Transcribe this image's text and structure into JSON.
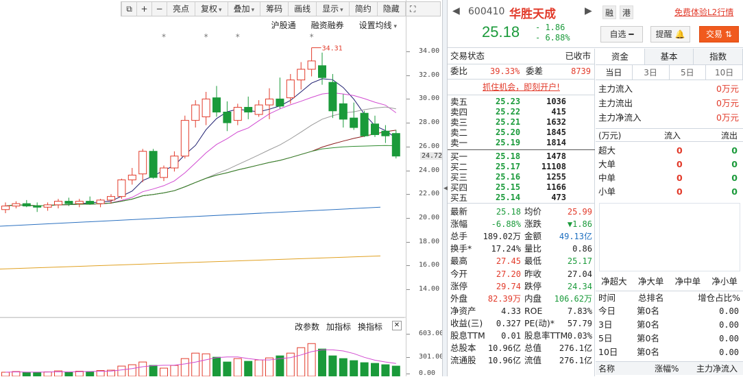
{
  "toolbar": {
    "items": [
      "亮点",
      "复权",
      "叠加",
      "筹码",
      "画线",
      "显示",
      "简约",
      "隐藏"
    ]
  },
  "subbar": {
    "hk": "沪股通",
    "margin": "融资融券",
    "ma": "设置均线"
  },
  "chart_data": {
    "type": "candlestick",
    "max_label": "34.31",
    "yticks": [
      "34.00",
      "32.00",
      "30.00",
      "28.00",
      "26.00",
      "24.00",
      "22.00",
      "20.00",
      "18.00",
      "16.00",
      "14.00"
    ],
    "y_current": "24.72",
    "vol_ticks": [
      "603.00",
      "301.00",
      "0.00"
    ],
    "ylim": [
      13,
      35.5
    ],
    "candles": [
      [
        20.7,
        21.3,
        20.4,
        21.0
      ],
      [
        21.0,
        21.4,
        20.8,
        21.2
      ],
      [
        21.2,
        21.5,
        20.9,
        21.0
      ],
      [
        21.0,
        21.3,
        20.5,
        20.9
      ],
      [
        20.9,
        21.3,
        20.6,
        21.1
      ],
      [
        21.1,
        21.6,
        20.8,
        21.4
      ],
      [
        21.4,
        21.7,
        21.0,
        21.2
      ],
      [
        21.2,
        21.6,
        20.9,
        21.4
      ],
      [
        21.4,
        21.8,
        21.1,
        21.2
      ],
      [
        21.2,
        21.6,
        20.9,
        21.5
      ],
      [
        21.5,
        22.0,
        21.2,
        21.8
      ],
      [
        21.8,
        23.3,
        21.6,
        23.2
      ],
      [
        23.2,
        24.2,
        22.8,
        23.6
      ],
      [
        23.7,
        25.8,
        23.0,
        25.6
      ],
      [
        25.6,
        25.8,
        23.3,
        23.4
      ],
      [
        23.4,
        24.4,
        23.1,
        24.2
      ],
      [
        24.2,
        25.6,
        23.9,
        25.2
      ],
      [
        25.2,
        28.6,
        25.0,
        28.2
      ],
      [
        28.2,
        29.9,
        27.6,
        29.5
      ],
      [
        28.5,
        30.6,
        27.8,
        30.0
      ],
      [
        30.1,
        31.1,
        28.5,
        28.9
      ],
      [
        28.9,
        29.8,
        27.3,
        28.0
      ],
      [
        28.2,
        29.6,
        27.8,
        29.3
      ],
      [
        29.3,
        30.2,
        28.3,
        28.9
      ],
      [
        28.7,
        29.9,
        28.5,
        29.5
      ],
      [
        29.5,
        30.9,
        28.3,
        30.0
      ],
      [
        30.0,
        31.8,
        29.2,
        29.4
      ],
      [
        30.1,
        32.1,
        29.6,
        31.6
      ],
      [
        31.6,
        33.1,
        30.8,
        32.5
      ],
      [
        32.5,
        34.31,
        31.9,
        33.2
      ],
      [
        32.8,
        33.9,
        31.2,
        31.8
      ],
      [
        31.4,
        32.1,
        28.4,
        29.0
      ],
      [
        29.6,
        30.4,
        27.6,
        28.3
      ],
      [
        28.4,
        29.7,
        27.4,
        27.6
      ],
      [
        28.8,
        29.0,
        26.8,
        26.9
      ],
      [
        27.9,
        28.6,
        26.8,
        27.0
      ],
      [
        27.3,
        27.8,
        26.3,
        26.9
      ],
      [
        27.1,
        27.4,
        25.0,
        25.2
      ]
    ]
  },
  "header": {
    "code": "600410",
    "name": "华胜天成",
    "tag1": "融",
    "tag2": "港",
    "l2": "免费体验L2行情",
    "price": "25.18",
    "chg": "- 1.86",
    "pct": "- 6.88%",
    "watch": "自选",
    "remind": "提醒",
    "trade": "交易"
  },
  "status": {
    "label": "交易状态",
    "value": "已收市"
  },
  "ratio": {
    "wb_label": "委比",
    "wb": "39.33%",
    "wc_label": "委差",
    "wc": "8739"
  },
  "promo": "抓住机会，即刻开户!",
  "asks": [
    {
      "label": "卖五",
      "price": "25.23",
      "vol": "1036"
    },
    {
      "label": "卖四",
      "price": "25.22",
      "vol": "415"
    },
    {
      "label": "卖三",
      "price": "25.21",
      "vol": "1632"
    },
    {
      "label": "卖二",
      "price": "25.20",
      "vol": "1845"
    },
    {
      "label": "卖一",
      "price": "25.19",
      "vol": "1814"
    }
  ],
  "bids": [
    {
      "label": "买一",
      "price": "25.18",
      "vol": "1478"
    },
    {
      "label": "买二",
      "price": "25.17",
      "vol": "11108"
    },
    {
      "label": "买三",
      "price": "25.16",
      "vol": "1255"
    },
    {
      "label": "买四",
      "price": "25.15",
      "vol": "1166"
    },
    {
      "label": "买五",
      "price": "25.14",
      "vol": "473"
    }
  ],
  "quote": [
    {
      "l1": "最新",
      "v1": "25.18",
      "c1": "green",
      "l2": "均价",
      "v2": "25.99",
      "c2": "red"
    },
    {
      "l1": "涨幅",
      "v1": "-6.88%",
      "c1": "green",
      "l2": "涨跌",
      "v2": "▼1.86",
      "c2": "green"
    },
    {
      "l1": "总手",
      "v1": "189.02万",
      "c1": "",
      "l2": "金额",
      "v2": "49.13亿",
      "c2": "blue"
    },
    {
      "l1": "换手*",
      "v1": "17.24%",
      "c1": "",
      "l2": "量比",
      "v2": "0.86",
      "c2": ""
    },
    {
      "l1": "最高",
      "v1": "27.45",
      "c1": "red",
      "l2": "最低",
      "v2": "25.17",
      "c2": "green"
    },
    {
      "l1": "今开",
      "v1": "27.20",
      "c1": "red",
      "l2": "昨收",
      "v2": "27.04",
      "c2": ""
    },
    {
      "l1": "涨停",
      "v1": "29.74",
      "c1": "red",
      "l2": "跌停",
      "v2": "24.34",
      "c2": "green"
    },
    {
      "l1": "外盘",
      "v1": "82.39万",
      "c1": "red",
      "l2": "内盘",
      "v2": "106.62万",
      "c2": "green"
    },
    {
      "l1": "净资产",
      "v1": "4.33",
      "c1": "",
      "l2": "ROE",
      "v2": "7.83%",
      "c2": ""
    },
    {
      "l1": "收益(三)",
      "v1": "0.327",
      "c1": "",
      "l2": "PE(动)*",
      "v2": "57.79",
      "c2": ""
    },
    {
      "l1": "股息TTM",
      "v1": "0.01",
      "c1": "",
      "l2": "股息率TTM",
      "v2": "0.03%",
      "c2": ""
    },
    {
      "l1": "总股本",
      "v1": "10.96亿",
      "c1": "",
      "l2": "总值",
      "v2": "276.1亿",
      "c2": ""
    },
    {
      "l1": "流通股",
      "v1": "10.96亿",
      "c1": "",
      "l2": "流值",
      "v2": "276.1亿",
      "c2": ""
    }
  ],
  "fundtabs": [
    "资金",
    "基本",
    "指数"
  ],
  "periodtabs": [
    "当日",
    "3日",
    "5日",
    "10日"
  ],
  "fund_rows": [
    {
      "label": "主力流入",
      "value": "0万元"
    },
    {
      "label": "主力流出",
      "value": "0万元"
    },
    {
      "label": "主力净流入",
      "value": "0万元"
    }
  ],
  "flow_header": {
    "unit": "(万元)",
    "in": "流入",
    "out": "流出"
  },
  "flow_rows": [
    {
      "label": "超大",
      "in": "0",
      "out": "0"
    },
    {
      "label": "大单",
      "in": "0",
      "out": "0"
    },
    {
      "label": "中单",
      "in": "0",
      "out": "0"
    },
    {
      "label": "小单",
      "in": "0",
      "out": "0"
    }
  ],
  "net_labels": [
    "净超大",
    "净大单",
    "净中单",
    "净小单"
  ],
  "rank_header": {
    "time": "时间",
    "rank": "总排名",
    "ratio": "增仓占比%"
  },
  "rank_rows": [
    {
      "t": "今日",
      "r": "第0名",
      "v": "0.00"
    },
    {
      "t": "3日",
      "r": "第0名",
      "v": "0.00"
    },
    {
      "t": "5日",
      "r": "第0名",
      "v": "0.00"
    },
    {
      "t": "10日",
      "r": "第0名",
      "v": "0.00"
    }
  ],
  "bottom_header": {
    "name": "名称",
    "pct": "涨幅%",
    "flow": "主力净流入"
  },
  "vol_tools": [
    "改参数",
    "加指标",
    "换指标"
  ]
}
